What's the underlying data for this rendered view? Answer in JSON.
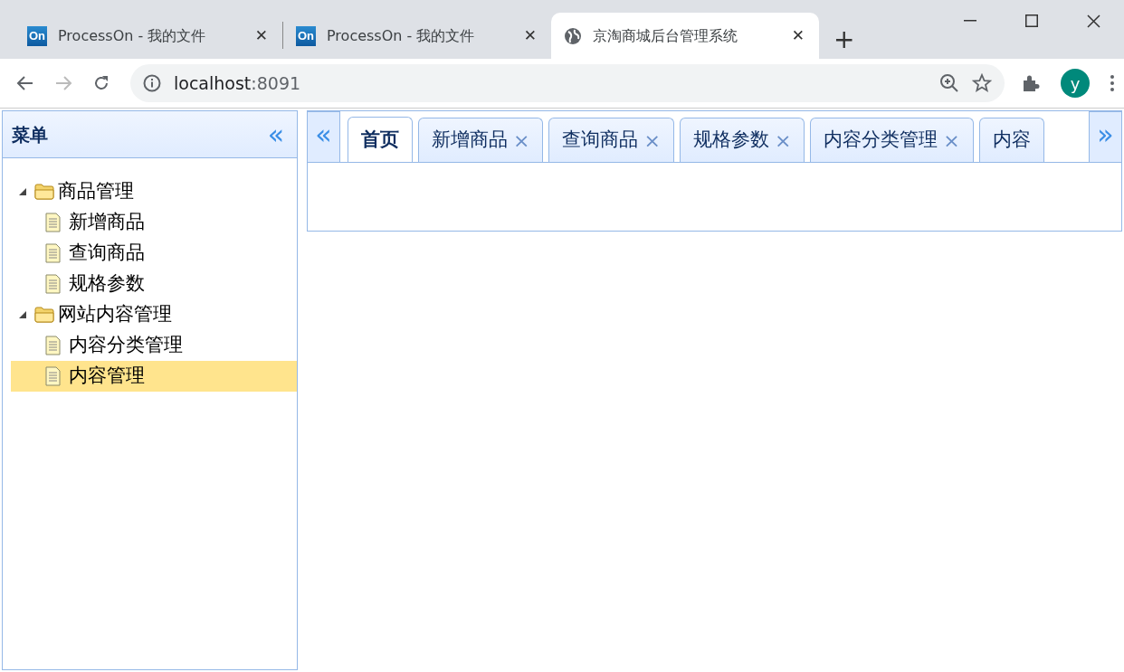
{
  "browser": {
    "tabs": [
      {
        "title": "ProcessOn - 我的文件",
        "icon": "On",
        "kind": "brand",
        "selected": false,
        "close": "✕"
      },
      {
        "title": "ProcessOn - 我的文件",
        "icon": "On",
        "kind": "brand",
        "selected": false,
        "close": "✕"
      },
      {
        "title": "京淘商城后台管理系统",
        "kind": "globe",
        "selected": true,
        "close": "✕"
      }
    ],
    "new_tab": "+",
    "url_host": "localhost",
    "url_port": ":8091",
    "profile": "y"
  },
  "sidebar": {
    "title": "菜单",
    "collapse": "«",
    "tree": [
      {
        "label": "商品管理",
        "kind": "folder",
        "expanded": true,
        "selected": false,
        "children": [
          {
            "label": "新增商品",
            "kind": "file",
            "selected": false
          },
          {
            "label": "查询商品",
            "kind": "file",
            "selected": false
          },
          {
            "label": "规格参数",
            "kind": "file",
            "selected": false
          }
        ]
      },
      {
        "label": "网站内容管理",
        "kind": "folder",
        "expanded": true,
        "selected": false,
        "children": [
          {
            "label": "内容分类管理",
            "kind": "file",
            "selected": false
          },
          {
            "label": "内容管理",
            "kind": "file",
            "selected": true
          }
        ]
      }
    ]
  },
  "main": {
    "scroll_left": "«",
    "scroll_right": "»",
    "tabs": [
      {
        "label": "首页",
        "closable": false,
        "selected": true
      },
      {
        "label": "新增商品",
        "closable": true,
        "selected": false
      },
      {
        "label": "查询商品",
        "closable": true,
        "selected": false
      },
      {
        "label": "规格参数",
        "closable": true,
        "selected": false
      },
      {
        "label": "内容分类管理",
        "closable": true,
        "selected": false
      },
      {
        "label": "内容",
        "closable": false,
        "selected": false
      }
    ],
    "close_glyph": "×"
  }
}
